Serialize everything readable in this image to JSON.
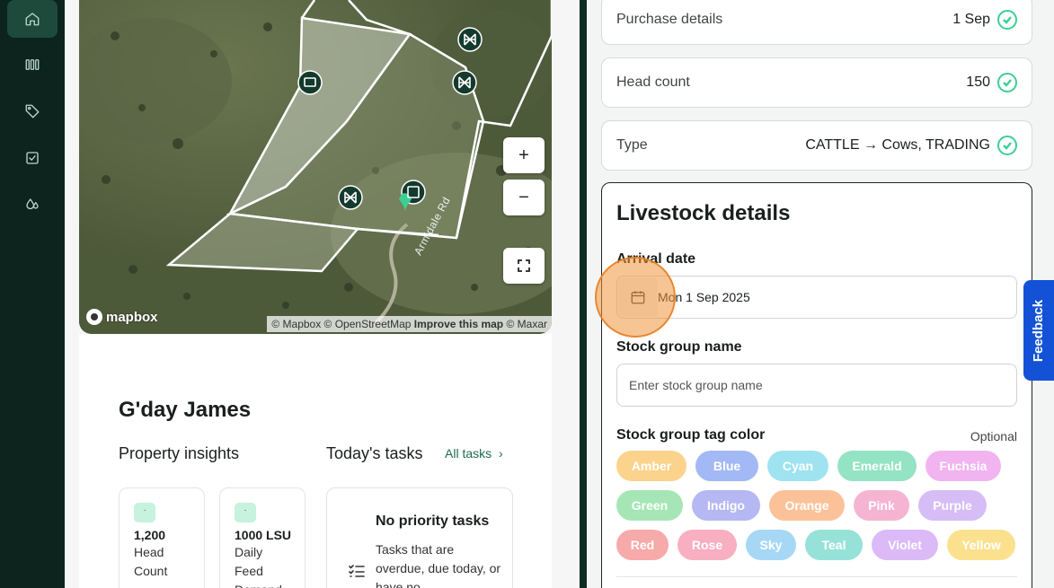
{
  "sidebar": {
    "items": [
      {
        "icon": "home-icon",
        "active": true
      },
      {
        "icon": "paddocks-icon",
        "active": false
      },
      {
        "icon": "tag-icon",
        "active": false
      },
      {
        "icon": "task-check-icon",
        "active": false
      },
      {
        "icon": "drops-icon",
        "active": false
      }
    ]
  },
  "map": {
    "zoom_in": "+",
    "zoom_out": "−",
    "logo": "mapbox",
    "attribution_prefix": "© Mapbox © OpenStreetMap",
    "attribution_link": "Improve this map",
    "attribution_suffix": "© Maxar",
    "road_label": "Armidale Rd"
  },
  "dashboard": {
    "greeting": "G'day James",
    "insights_heading": "Property insights",
    "tasks_heading": "Today's tasks",
    "all_tasks_link": "All tasks",
    "stats": [
      {
        "chip": "·",
        "value": "1,200",
        "label": "Head Count"
      },
      {
        "chip": "·",
        "value": "1000  LSU",
        "label": "Daily Feed Demand"
      }
    ],
    "task_card": {
      "title": "No priority tasks",
      "body": "Tasks that are overdue, due today, or have no"
    }
  },
  "panel": {
    "rows": [
      {
        "label": "Purchase details",
        "value": "1 Sep"
      },
      {
        "label": "Head count",
        "value": "150"
      },
      {
        "label": "Type",
        "value": "CATTLE → Cows, TRADING"
      }
    ],
    "livestock": {
      "title": "Livestock details",
      "arrival_label": "Arrival date",
      "arrival_value": "Mon 1 Sep 2025",
      "group_name_label": "Stock group name",
      "group_name_placeholder": "Enter stock group name",
      "tag_color_label": "Stock group tag color",
      "optional": "Optional",
      "colors": [
        {
          "name": "Amber",
          "hex": "#fbd38d"
        },
        {
          "name": "Blue",
          "hex": "#a3b9f5"
        },
        {
          "name": "Cyan",
          "hex": "#9fe3f0"
        },
        {
          "name": "Emerald",
          "hex": "#93e3c4"
        },
        {
          "name": "Fuchsia",
          "hex": "#f1b4f1"
        },
        {
          "name": "Green",
          "hex": "#a6e6b6"
        },
        {
          "name": "Indigo",
          "hex": "#b6b8f3"
        },
        {
          "name": "Orange",
          "hex": "#fbc29a"
        },
        {
          "name": "Pink",
          "hex": "#f6b4d3"
        },
        {
          "name": "Purple",
          "hex": "#d6bdf6"
        },
        {
          "name": "Red",
          "hex": "#f7aaaa"
        },
        {
          "name": "Rose",
          "hex": "#f8afc2"
        },
        {
          "name": "Sky",
          "hex": "#a6d8f6"
        },
        {
          "name": "Teal",
          "hex": "#97e2d8"
        },
        {
          "name": "Violet",
          "hex": "#dcbaf7"
        },
        {
          "name": "Yellow",
          "hex": "#fbe18e"
        }
      ]
    }
  },
  "feedback": "Feedback"
}
